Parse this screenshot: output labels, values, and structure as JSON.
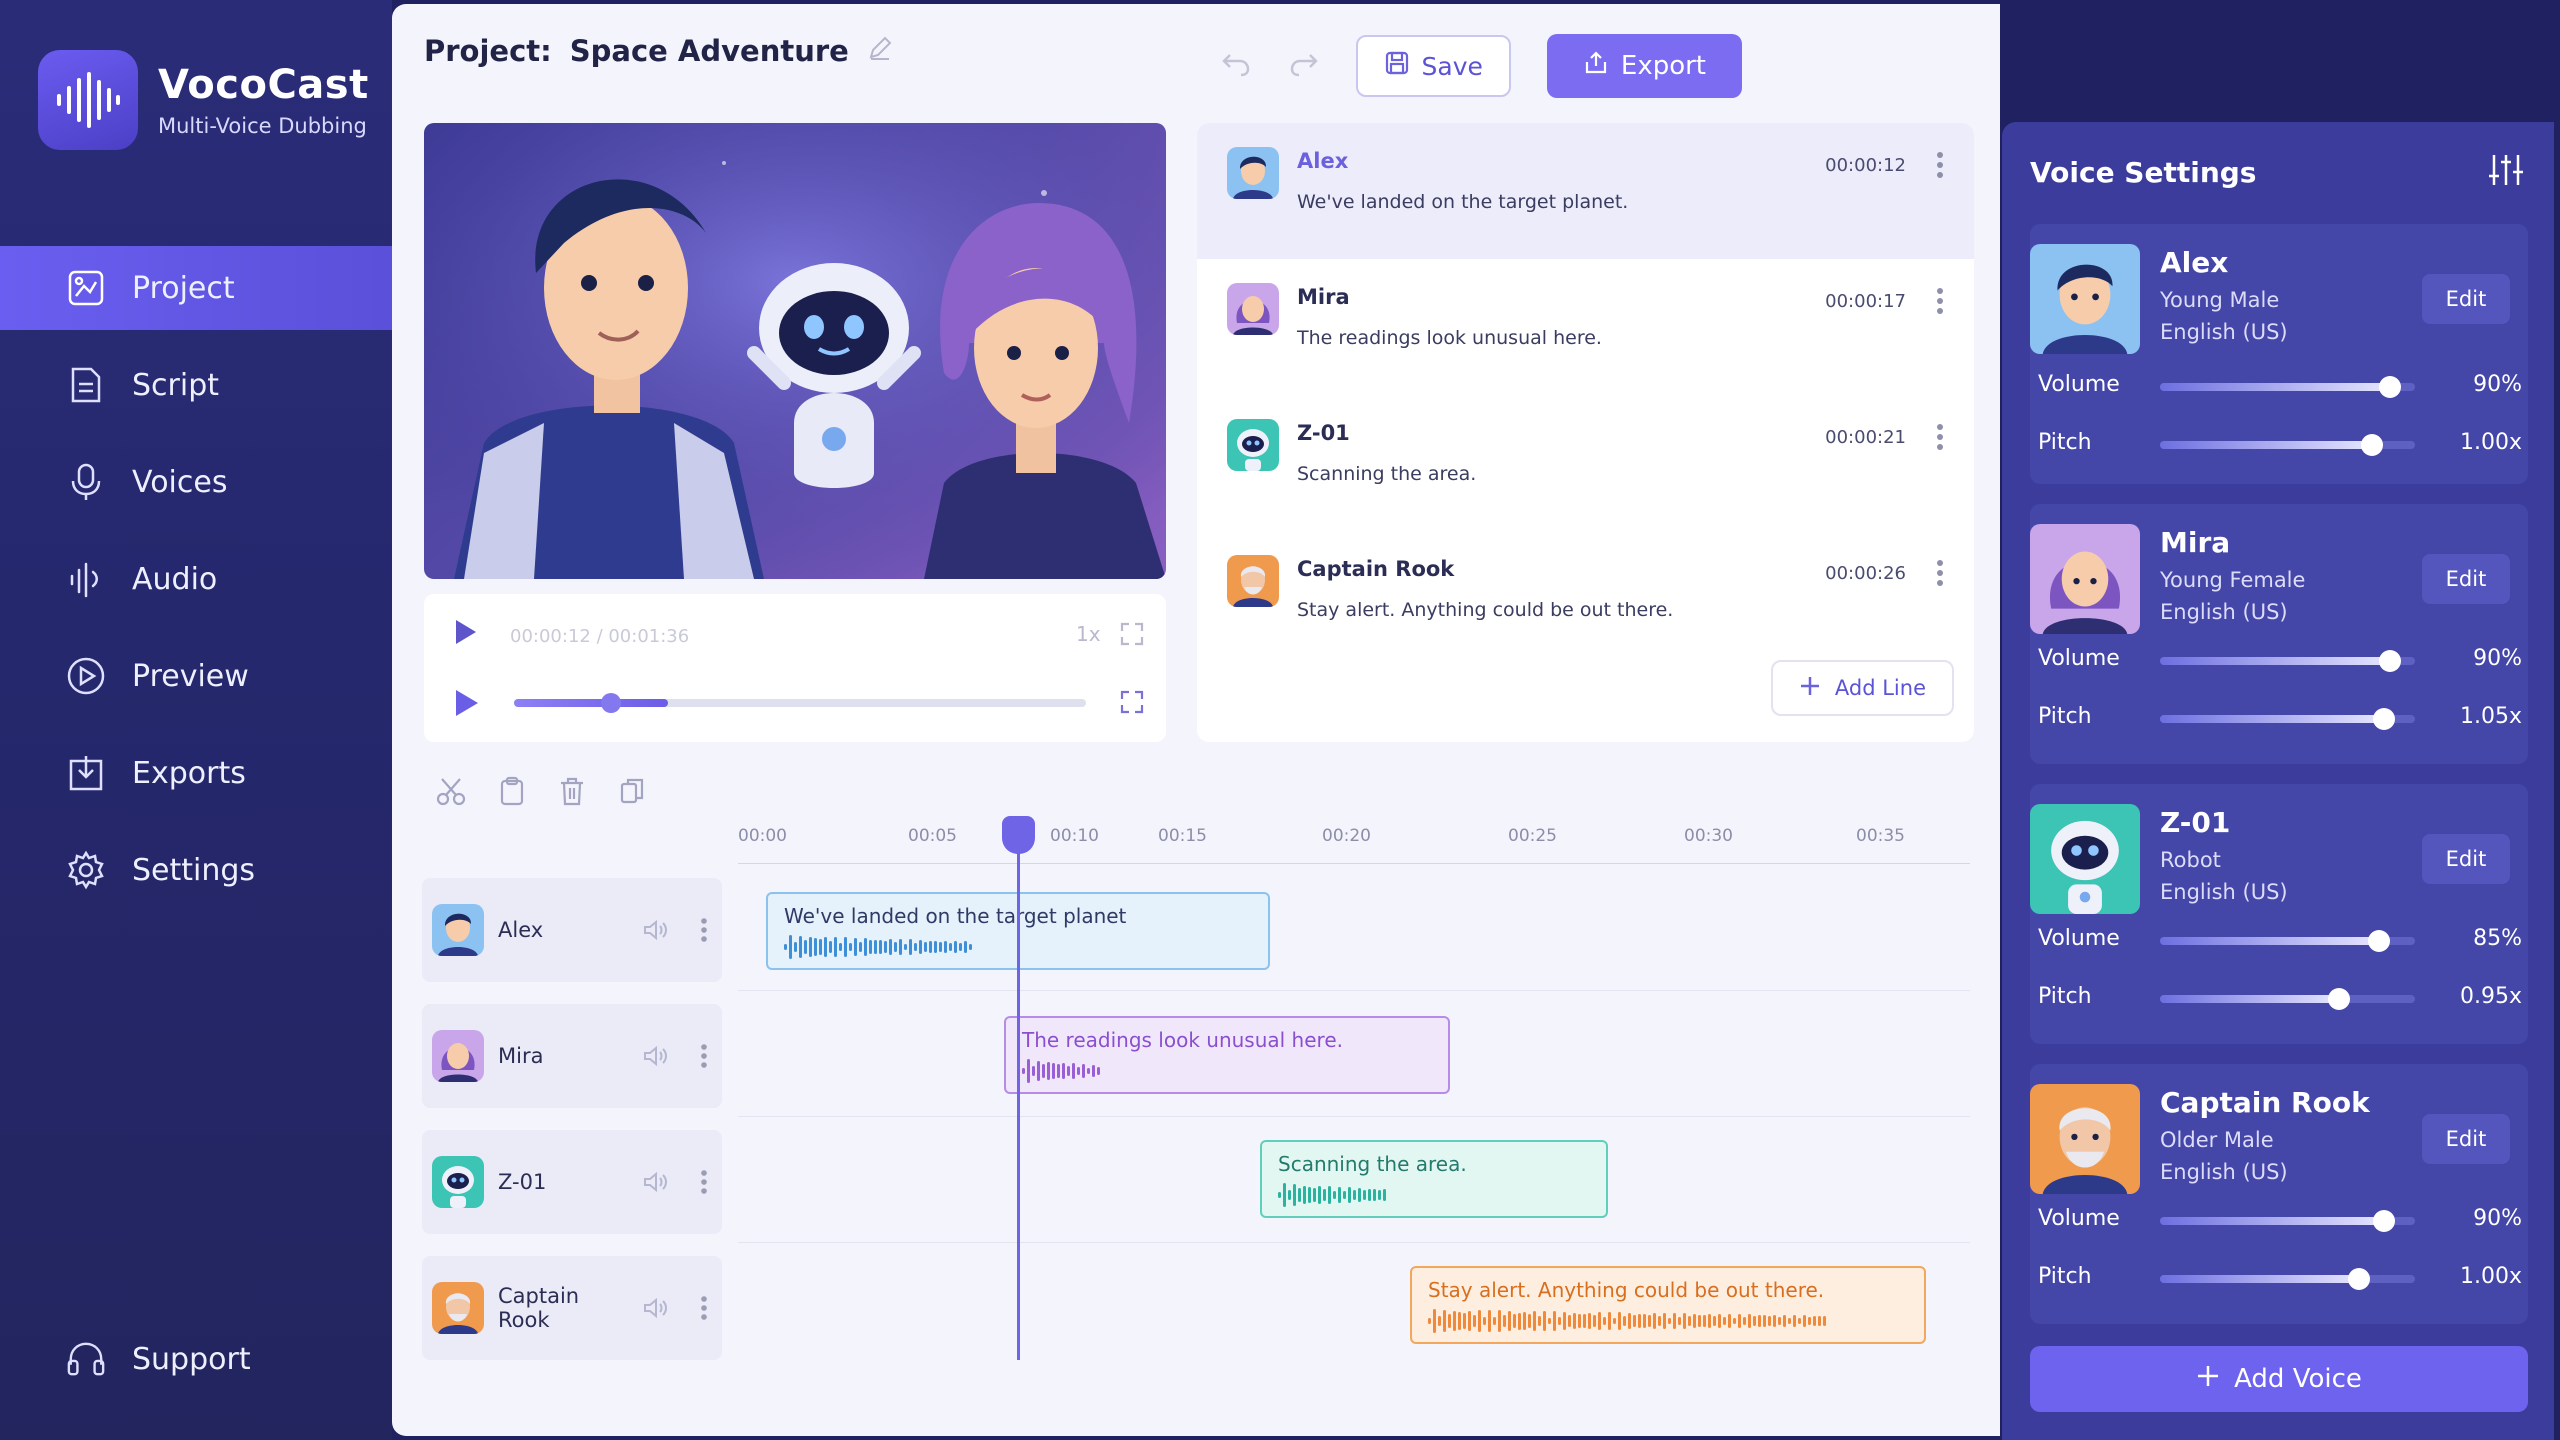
{
  "app": {
    "name": "VocoCast",
    "subtitle": "Multi-Voice Dubbing"
  },
  "nav": [
    {
      "label": "Project",
      "icon": "project-icon",
      "active": true
    },
    {
      "label": "Script",
      "icon": "script-icon"
    },
    {
      "label": "Voices",
      "icon": "microphone-icon"
    },
    {
      "label": "Audio",
      "icon": "audio-icon"
    },
    {
      "label": "Preview",
      "icon": "play-icon"
    },
    {
      "label": "Exports",
      "icon": "export-icon"
    },
    {
      "label": "Settings",
      "icon": "gear-icon"
    }
  ],
  "support": {
    "label": "Support"
  },
  "header": {
    "project_label": "Project:",
    "project_name": "Space Adventure",
    "save": "Save",
    "export": "Export"
  },
  "player": {
    "time": "00:00:12 / 00:01:36",
    "speed": "1x",
    "progress": 0.27,
    "knob": 0.17
  },
  "script": {
    "lines": [
      {
        "name": "Alex",
        "time": "00:00:12",
        "text": "We've landed on the target planet.",
        "selected": true
      },
      {
        "name": "Mira",
        "time": "00:00:17",
        "text": "The readings look unusual here."
      },
      {
        "name": "Z-01",
        "time": "00:00:21",
        "text": "Scanning the area."
      },
      {
        "name": "Captain Rook",
        "time": "00:00:26",
        "text": "Stay alert. Anything could be out there."
      }
    ],
    "add_line": "Add Line"
  },
  "timeline": {
    "ticks": [
      "00:00",
      "00:05",
      "00:10",
      "00:15",
      "00:20",
      "00:25",
      "00:30",
      "00:35"
    ],
    "tracks": [
      {
        "name": "Alex",
        "clip": "We've landed on the target planet",
        "color": "#4aa3e0"
      },
      {
        "name": "Mira",
        "clip": "The readings look unusual here.",
        "color": "#9a5fd6"
      },
      {
        "name": "Z-01",
        "clip": "Scanning the area.",
        "color": "#2bb3a0"
      },
      {
        "name": "Captain Rook",
        "clip": "Stay alert. Anything could be out there.",
        "color": "#ef8a3c"
      }
    ]
  },
  "voice_settings": {
    "title": "Voice Settings",
    "volume_label": "Volume",
    "pitch_label": "Pitch",
    "edit_label": "Edit",
    "voices": [
      {
        "name": "Alex",
        "type": "Young Male",
        "lang": "English (US)",
        "volume": "90%",
        "pitch": "1.00x",
        "vol_frac": 0.9,
        "pitch_frac": 0.83
      },
      {
        "name": "Mira",
        "type": "Young Female",
        "lang": "English (US)",
        "volume": "90%",
        "pitch": "1.05x",
        "vol_frac": 0.9,
        "pitch_frac": 0.88
      },
      {
        "name": "Z-01",
        "type": "Robot",
        "lang": "English (US)",
        "volume": "85%",
        "pitch": "0.95x",
        "vol_frac": 0.86,
        "pitch_frac": 0.7
      },
      {
        "name": "Captain Rook",
        "type": "Older Male",
        "lang": "English (US)",
        "volume": "90%",
        "pitch": "1.00x",
        "vol_frac": 0.88,
        "pitch_frac": 0.78
      }
    ],
    "add_voice": "Add Voice"
  }
}
